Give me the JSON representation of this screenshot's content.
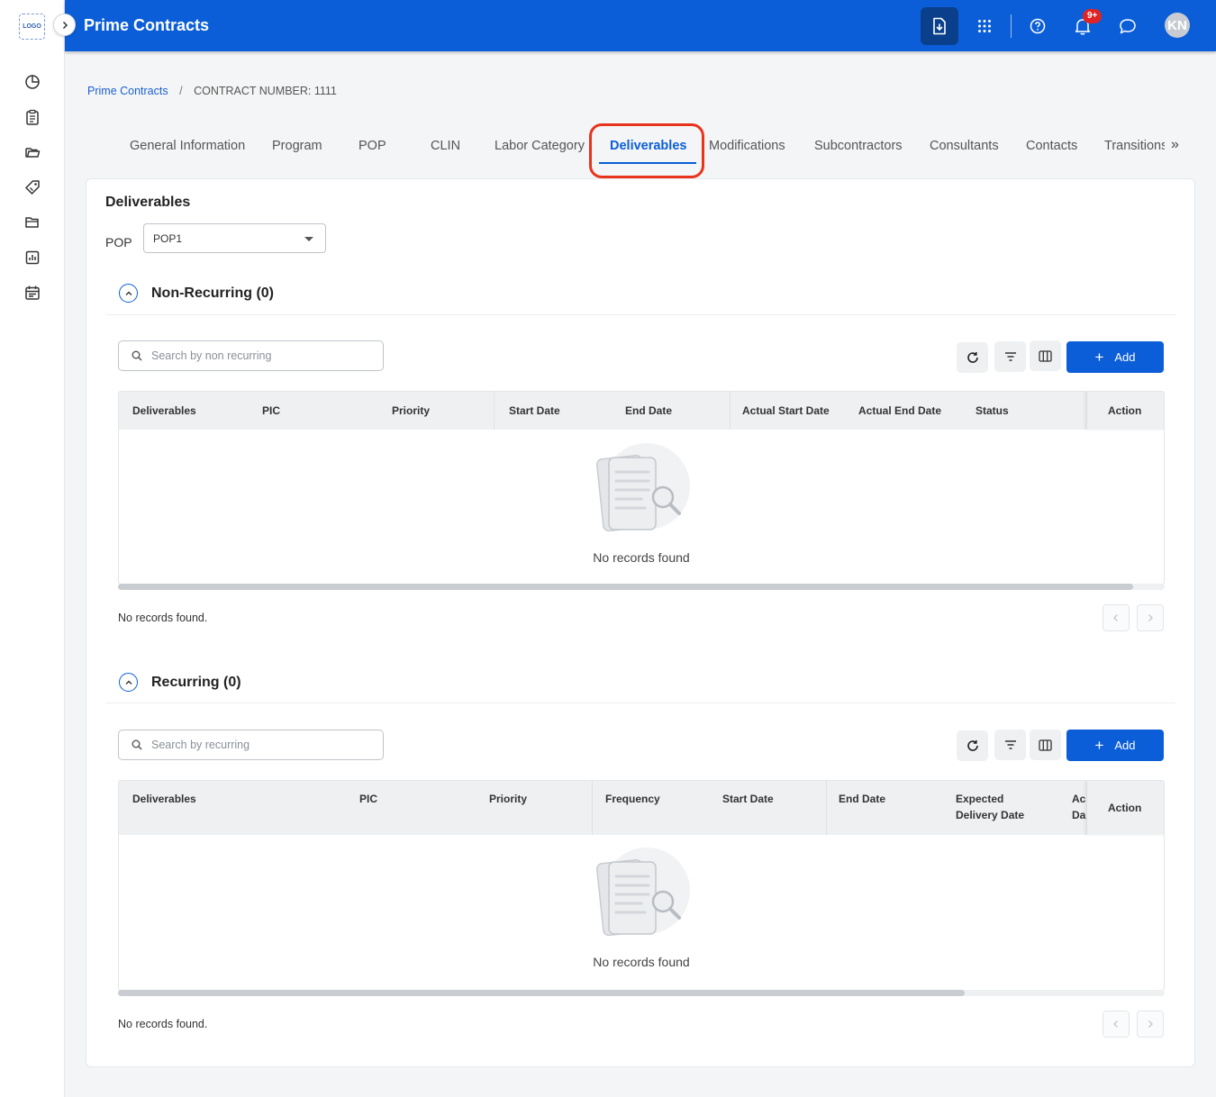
{
  "sidebar": {
    "logo_text": "LOGO",
    "items": [
      {
        "icon": "pie-chart-icon"
      },
      {
        "icon": "clipboard-icon"
      },
      {
        "icon": "folder-icon"
      },
      {
        "icon": "tag-icon"
      },
      {
        "icon": "open-folder-icon"
      },
      {
        "icon": "bar-report-icon"
      },
      {
        "icon": "calendar-icon"
      }
    ]
  },
  "header": {
    "title": "Prime Contracts",
    "notification_badge": "9+",
    "avatar_initials": "KN",
    "accent_color": "#0b5ed7"
  },
  "breadcrumb": {
    "link": "Prime Contracts",
    "separator": "/",
    "current": "CONTRACT NUMBER: 1111"
  },
  "tabs": [
    {
      "label": "General Information"
    },
    {
      "label": "Program"
    },
    {
      "label": "POP"
    },
    {
      "label": "CLIN"
    },
    {
      "label": "Labor Category"
    },
    {
      "label": "Deliverables",
      "active": true
    },
    {
      "label": "Modifications"
    },
    {
      "label": "Subcontractors"
    },
    {
      "label": "Consultants"
    },
    {
      "label": "Contacts"
    },
    {
      "label": "Transitions"
    }
  ],
  "tabs_more": "»",
  "content": {
    "title": "Deliverables",
    "pop_label": "POP",
    "pop_value": "POP1",
    "non_recurring": {
      "title": "Non-Recurring (0)",
      "search_placeholder": "Search by non recurring",
      "add_label": "Add",
      "columns": [
        "Deliverables",
        "PIC",
        "Priority",
        "Start Date",
        "End Date",
        "Actual Start Date",
        "Actual End Date",
        "Status"
      ],
      "action_column": "Action",
      "empty_text": "No records found",
      "footer_text": "No records found."
    },
    "recurring": {
      "title": "Recurring (0)",
      "search_placeholder": "Search by recurring",
      "add_label": "Add",
      "columns": [
        "Deliverables",
        "PIC",
        "Priority",
        "Frequency",
        "Start Date",
        "End Date",
        "Expected Delivery Date",
        "Ac Da"
      ],
      "action_column": "Action",
      "empty_text": "No records found",
      "footer_text": "No records found."
    }
  }
}
